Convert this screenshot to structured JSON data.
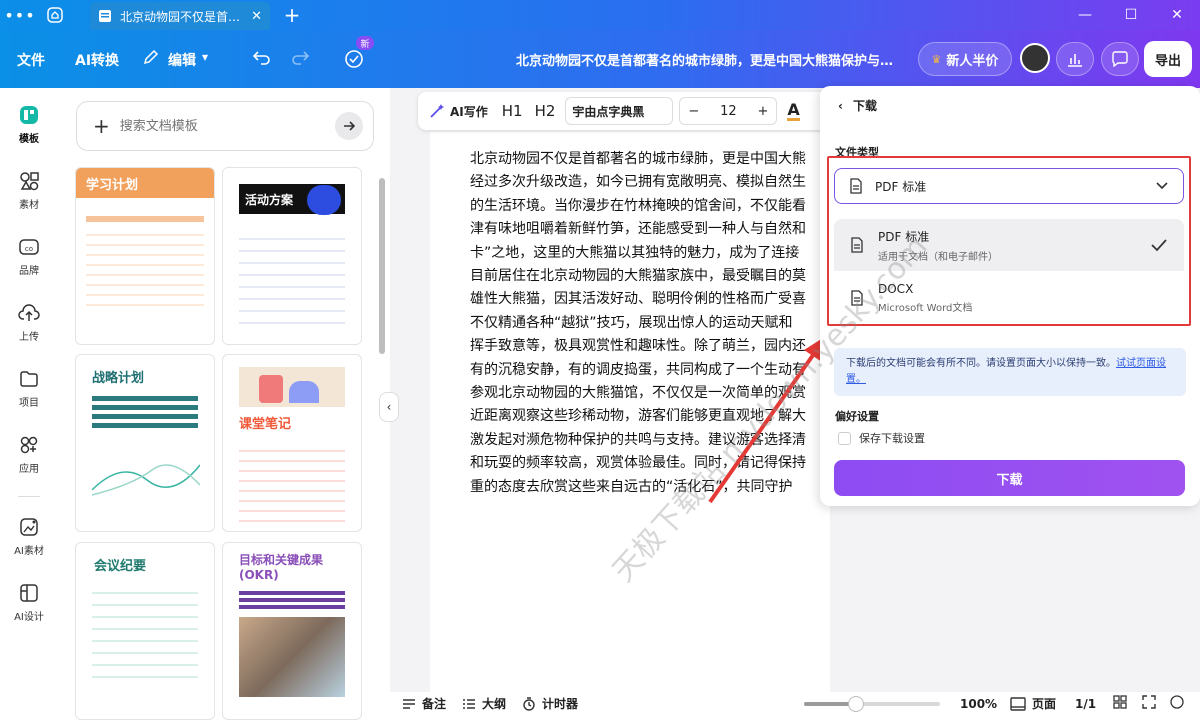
{
  "titlebar": {
    "tab_title": "北京动物园不仅是首…",
    "menu_dots": "•••",
    "plus": "+"
  },
  "toolbar": {
    "file": "文件",
    "ai_convert": "AI转换",
    "edit": "编辑",
    "new_badge": "新",
    "doc_title": "北京动物园不仅是首都著名的城市绿肺，更是中国大熊猫保护与…",
    "promo": "新人半价",
    "export": "导出"
  },
  "leftrail": {
    "items": [
      {
        "label": "模板",
        "icon": "template-icon"
      },
      {
        "label": "素材",
        "icon": "assets-icon"
      },
      {
        "label": "品牌",
        "icon": "brand-icon"
      },
      {
        "label": "上传",
        "icon": "upload-icon"
      },
      {
        "label": "项目",
        "icon": "folder-icon"
      },
      {
        "label": "应用",
        "icon": "apps-icon"
      },
      {
        "label": "AI素材",
        "icon": "ai-assets-icon"
      },
      {
        "label": "AI设计",
        "icon": "ai-design-icon"
      }
    ]
  },
  "templates": {
    "search_placeholder": "搜索文档模板",
    "cards": [
      {
        "title": "学习计划"
      },
      {
        "title": "活动方案"
      },
      {
        "title": "战略计划"
      },
      {
        "title": "课堂笔记"
      },
      {
        "title": "会议纪要"
      },
      {
        "title": "目标和关键成果(OKR)"
      }
    ]
  },
  "format": {
    "ai_write": "AI写作",
    "h1": "H1",
    "h2": "H2",
    "font": "宇由点字典黑",
    "minus": "−",
    "size": "12",
    "plus": "+",
    "font_color": "A"
  },
  "document": {
    "paragraphs": [
      [
        "北京动物园不仅是首都著名的城市绿肺，更是中国大熊",
        "经过多次升级改造，如今已拥有宽敞明亮、模拟自然生",
        "的生活环境。当你漫步在竹林掩映的馆舍间，不仅能看",
        "津有味地咀嚼着新鲜竹笋，还能感受到一种人与自然和",
        "卡”之地，这里的大熊猫以其独特的魅力，成为了连接"
      ],
      [
        "目前居住在北京动物园的大熊猫家族中，最受瞩目的莫",
        "雄性大熊猫，因其活泼好动、聪明伶俐的性格而广受喜",
        "不仅精通各种“越狱”技巧，展现出惊人的运动天赋和",
        "挥手致意等，极具观赏性和趣味性。除了萌兰，园内还",
        "有的沉稳安静，有的调皮捣蛋，共同构成了一个生动有"
      ],
      [
        "参观北京动物园的大熊猫馆，不仅仅是一次简单的观赏",
        "近距离观察这些珍稀动物，游客们能够更直观地了解大",
        "激发起对濒危物种保护的共鸣与支持。建议游客选择清",
        "和玩耍的频率较高，观赏体验最佳。同时，请记得保持",
        "重的态度去欣赏这些来自远古的“活化石”，共同守护"
      ]
    ]
  },
  "bottombar": {
    "notes": "备注",
    "outline": "大纲",
    "timer": "计时器",
    "zoom": "100%",
    "page_label": "页面",
    "page_count": "1/1",
    "slider_fraction": 0.38
  },
  "download_panel": {
    "back_title": "下载",
    "file_type_label": "文件类型",
    "selected": "PDF 标准",
    "options": [
      {
        "name": "PDF 标准",
        "desc": "适用于文档（和电子邮件）",
        "selected": true
      },
      {
        "name": "DOCX",
        "desc": "Microsoft Word文档",
        "selected": false
      }
    ],
    "info_text": "下载后的文档可能会有所不同。请设置页面大小以保持一致。",
    "info_link": "试试页面设置。",
    "pref_label": "偏好设置",
    "save_setting": "保存下载设置",
    "download_button": "下载"
  },
  "watermark": "天极下载站 mydown.yesky.com",
  "colors": {
    "accent": "#8d4cf2",
    "highlight_box": "#e03a3a",
    "toolbar_start": "#0a90e6",
    "toolbar_end": "#7f38ef"
  }
}
